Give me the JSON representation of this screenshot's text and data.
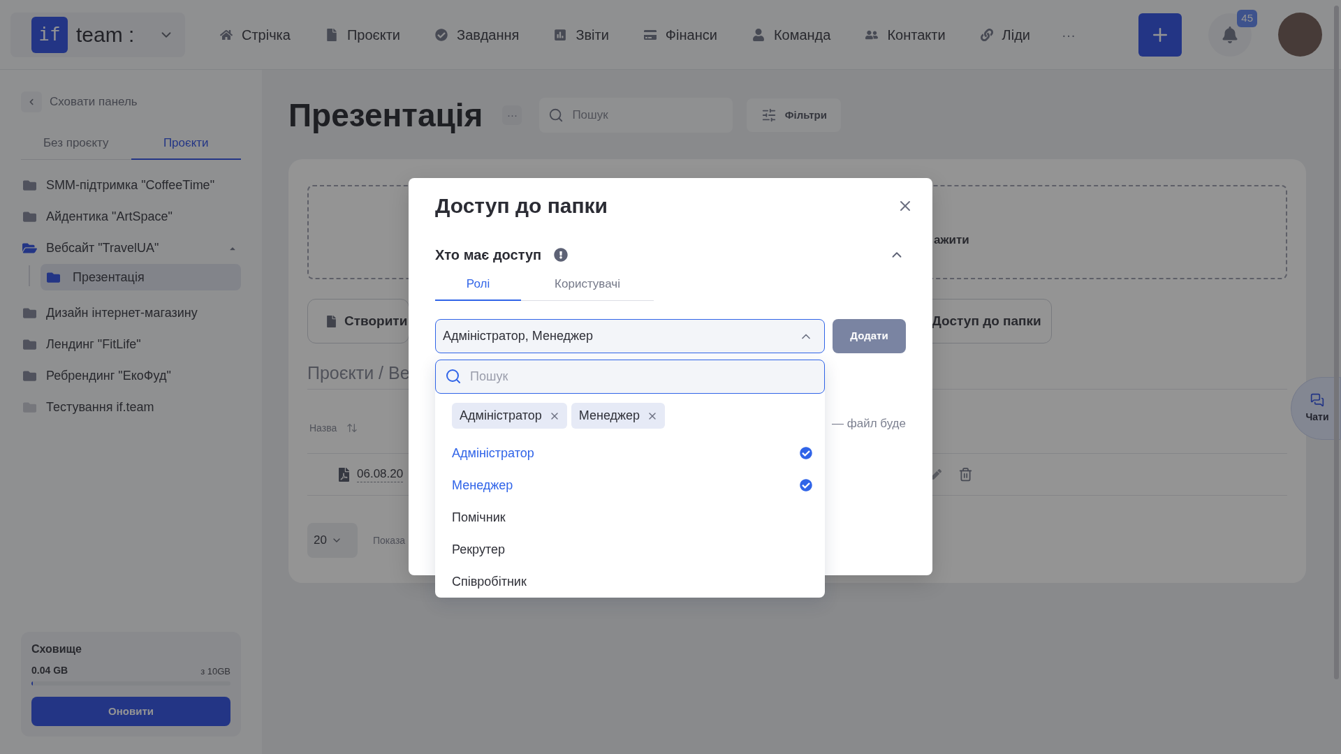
{
  "header": {
    "logo": {
      "mark": "if",
      "name": "team :"
    },
    "nav": [
      {
        "label": "Стрічка"
      },
      {
        "label": "Проєкти"
      },
      {
        "label": "Завдання"
      },
      {
        "label": "Звіти"
      },
      {
        "label": "Фінанси"
      },
      {
        "label": "Команда"
      },
      {
        "label": "Контакти"
      },
      {
        "label": "Ліди"
      }
    ],
    "more": "···",
    "notifications": "45"
  },
  "sidebar": {
    "collapse": "Сховати панель",
    "tabs": [
      {
        "label": "Без проєкту",
        "selected": false
      },
      {
        "label": "Проєкти",
        "selected": true
      }
    ],
    "folders": [
      {
        "name": "SMM-підтримка \"CoffeeTime\"",
        "selected": false,
        "expanded": false,
        "faded": false
      },
      {
        "name": "Айдентика \"ArtSpace\"",
        "selected": false,
        "expanded": false,
        "faded": false
      },
      {
        "name": "Вебсайт \"TravelUA\"",
        "selected": false,
        "expanded": true,
        "faded": false,
        "children": [
          {
            "name": "Презентація",
            "selected": true
          }
        ]
      },
      {
        "name": "Дизайн інтернет-магазину",
        "selected": false,
        "expanded": false,
        "faded": false
      },
      {
        "name": "Лендинг \"FitLife\"",
        "selected": false,
        "expanded": false,
        "faded": false
      },
      {
        "name": "Ребрендинг \"ЕкоФуд\"",
        "selected": false,
        "expanded": false,
        "faded": false
      },
      {
        "name": "Тестування if.team",
        "selected": false,
        "expanded": false,
        "faded": true
      }
    ],
    "storage": {
      "title": "Сховище",
      "used": "0.04 GB",
      "total": "з 10GB",
      "level": 0.004,
      "button": "Оновити"
    }
  },
  "page": {
    "title": "Презентація",
    "more": "···",
    "search": {
      "placeholder": "Пошук"
    },
    "filters": "Фільтри",
    "upload": "ажити",
    "actions": [
      "Створити",
      "Доступ до папки"
    ],
    "breadcrumb": "Проєкти / Ве",
    "table": {
      "columns": [
        {
          "label": "Назва"
        }
      ],
      "rows": [
        {
          "name": "06.08.20"
        }
      ]
    },
    "pagination": {
      "page_size": "20",
      "summary": "Показа"
    }
  },
  "chat": {
    "label": "Чати"
  },
  "modal": {
    "title": "Доступ до папки",
    "access": {
      "title": "Хто має доступ",
      "expanded": true
    },
    "tabs": [
      {
        "label": "Ролі",
        "selected": true
      },
      {
        "label": "Користувачі",
        "selected": false
      }
    ],
    "select": {
      "value": "Адміністратор, Менеджер",
      "expanded": true
    },
    "add_button": "Додати",
    "note": "— файл буде",
    "dropdown": {
      "search_placeholder": "Пошук",
      "tags": [
        "Адміністратор",
        "Менеджер"
      ],
      "options": [
        {
          "label": "Адміністратор",
          "checked": true
        },
        {
          "label": "Менеджер",
          "checked": true
        },
        {
          "label": "Помічник",
          "checked": false
        },
        {
          "label": "Рекрутер",
          "checked": false
        },
        {
          "label": "Співробітник",
          "checked": false
        }
      ]
    }
  }
}
